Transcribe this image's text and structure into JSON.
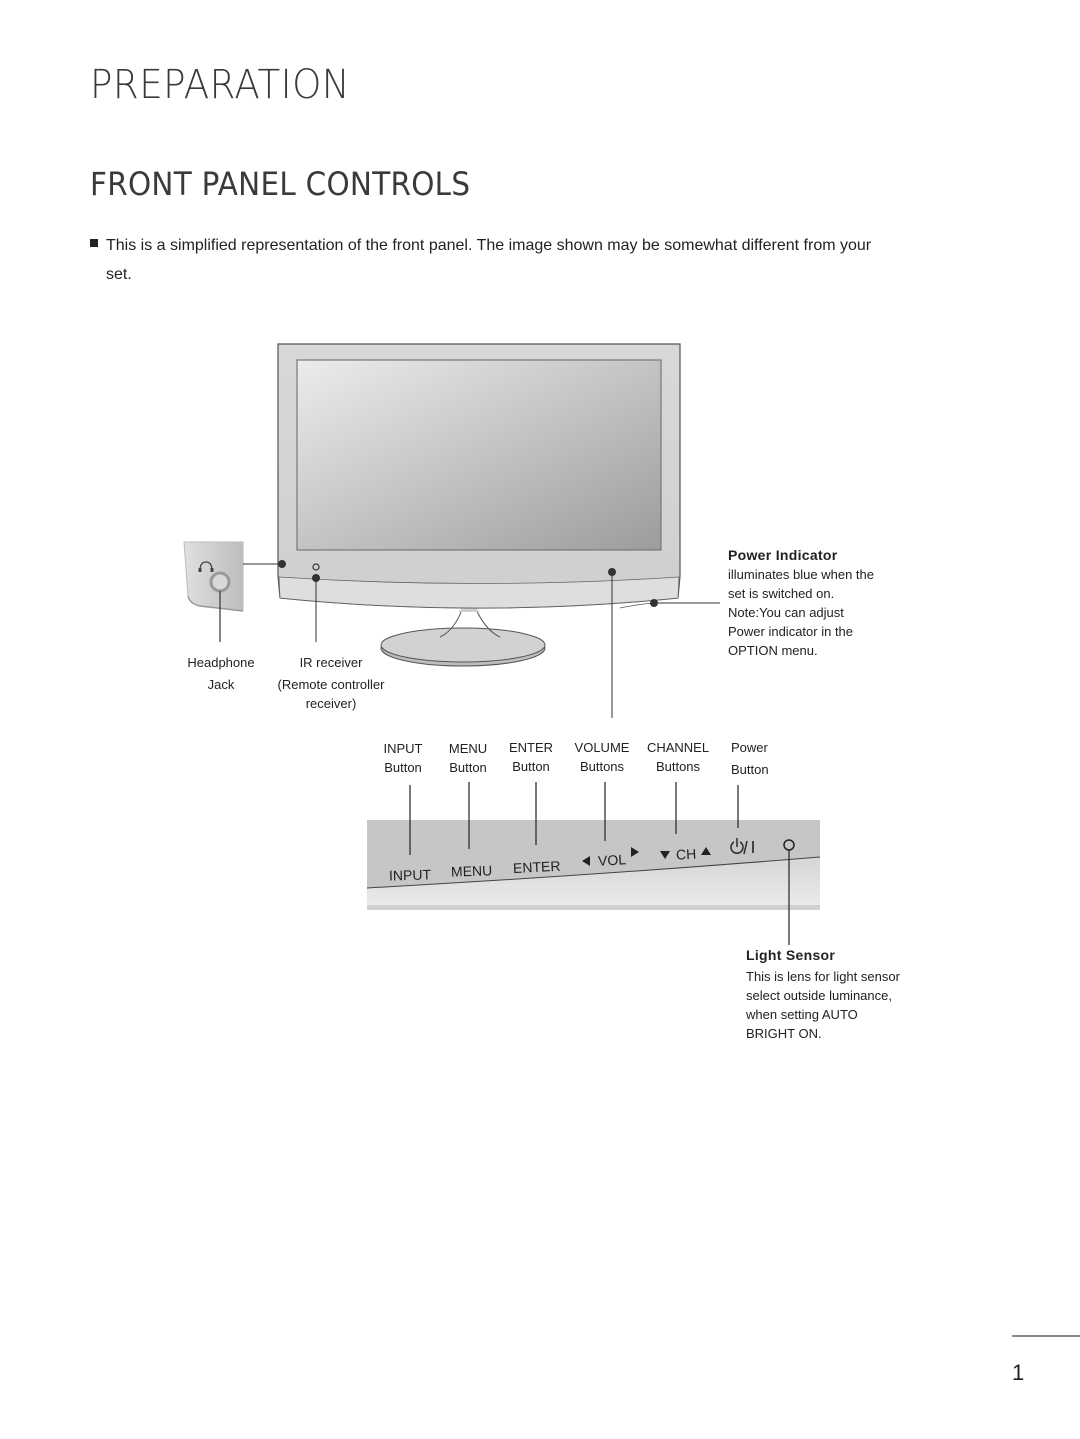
{
  "page": {
    "section_title": "PREPARATION",
    "subsection_title": "FRONT PANEL CONTROLS",
    "note_line1": "This is a simplified representation of the front panel. The image shown may be somewhat different from your",
    "note_line2": "set.",
    "page_number": "1"
  },
  "callouts": {
    "headphone": {
      "line1": "Headphone",
      "line2": "Jack"
    },
    "ir_receiver": {
      "line1": "IR receiver",
      "line2": "(Remote controller",
      "line3": "receiver)"
    },
    "power_indicator": {
      "title": "Power Indicator",
      "lines": [
        "illuminates blue when the",
        "set is switched on.",
        "Note:You can adjust",
        "Power indicator in the",
        "OPTION menu."
      ]
    },
    "light_sensor": {
      "title": "Light Sensor",
      "lines": [
        "This is lens for light sensor",
        "select outside luminance,",
        "when setting AUTO",
        "BRIGHT ON."
      ]
    }
  },
  "button_labels": [
    {
      "name": "INPUT",
      "sub": "Button"
    },
    {
      "name": "MENU",
      "sub": "Button"
    },
    {
      "name": "ENTER",
      "sub": "Button"
    },
    {
      "name": "VOLUME",
      "sub": "Buttons"
    },
    {
      "name": "CHANNEL",
      "sub": "Buttons"
    },
    {
      "name": "Power",
      "sub": "Button"
    }
  ],
  "panel_strip": {
    "input": "INPUT",
    "menu": "MENU",
    "enter": "ENTER",
    "vol": "VOL",
    "ch": "CH",
    "power_symbol": "⏻/I"
  },
  "colors": {
    "bezel": "#d4d4d4",
    "screen_light": "#e8e8e8",
    "screen_dark": "#9e9e9e",
    "strip": "#c4c4c4",
    "strip_lower": "#e0e0e0"
  }
}
